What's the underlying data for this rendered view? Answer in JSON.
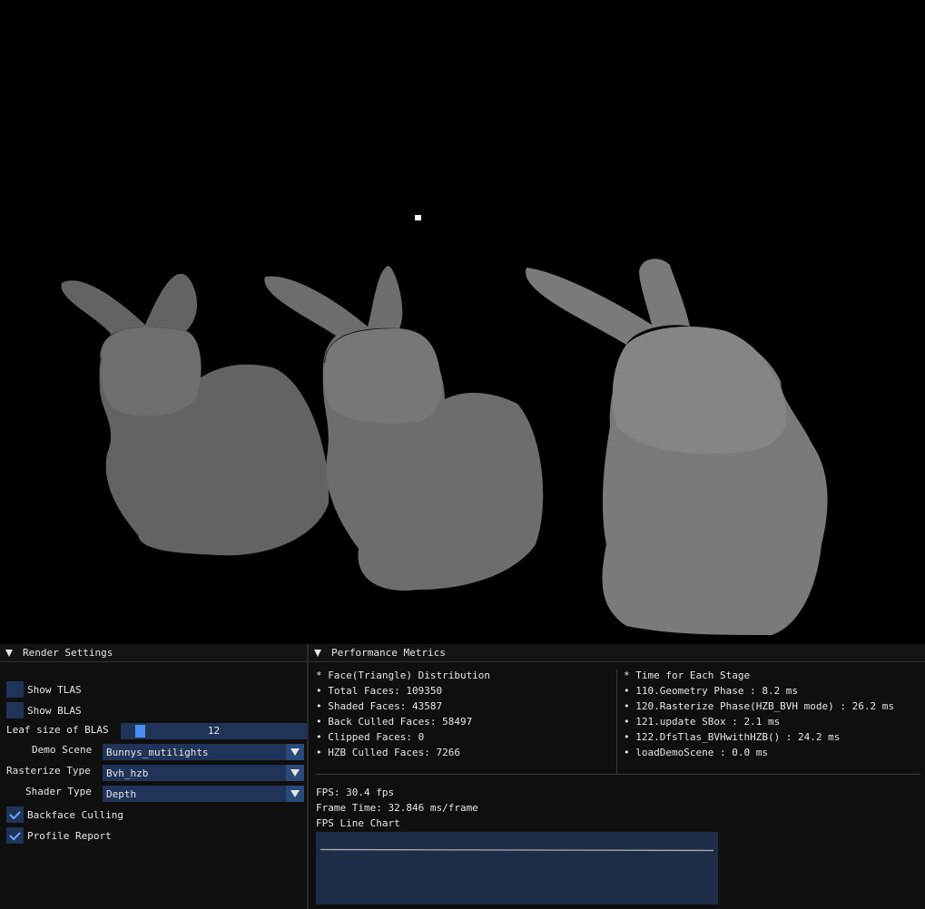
{
  "render_settings": {
    "title": "Render Settings",
    "show_tlas": {
      "label": "Show TLAS",
      "checked": false
    },
    "show_blas": {
      "label": "Show BLAS",
      "checked": false
    },
    "leaf_size": {
      "label": "Leaf size of BLAS",
      "value": "12",
      "fraction": 0.08
    },
    "demo_scene": {
      "label": "Demo Scene",
      "value": "Bunnys_mutilights"
    },
    "rasterize_type": {
      "label": "Rasterize Type",
      "value": "Bvh_hzb"
    },
    "shader_type": {
      "label": "Shader Type",
      "value": "Depth"
    },
    "backface_culling": {
      "label": "Backface Culling",
      "checked": true
    },
    "profile_report": {
      "label": "Profile Report",
      "checked": true
    }
  },
  "performance": {
    "title": "Performance Metrics",
    "faces": {
      "header": "* Face(Triangle) Distribution",
      "items": [
        "• Total Faces: 109350",
        "• Shaded Faces: 43587",
        "• Back Culled Faces: 58497",
        "• Clipped Faces: 0",
        "• HZB Culled Faces: 7266"
      ]
    },
    "stages": {
      "header": "* Time for Each Stage",
      "items": [
        "• 110.Geometry Phase : 8.2 ms",
        "• 120.Rasterize Phase(HZB_BVH mode) : 26.2 ms",
        "• 121.update SBox : 2.1 ms",
        "• 122.DfsTlas_BVHwithHZB() : 24.2 ms",
        "• loadDemoScene : 0.0 ms"
      ]
    },
    "fps": "FPS: 30.4 fps",
    "frame_time": "Frame Time: 32.846 ms/frame",
    "chart_title": "FPS Line Chart"
  },
  "colors": {
    "accent": "#4a8ef0",
    "widget_bg": "#1f3458",
    "panel_bg": "#0f0f0f"
  }
}
